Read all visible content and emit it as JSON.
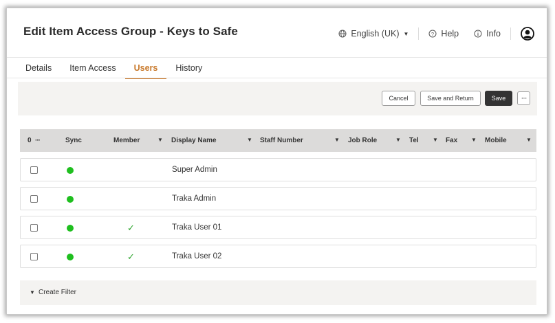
{
  "header": {
    "title": "Edit Item Access Group - Keys to Safe",
    "language": "English (UK)",
    "help": "Help",
    "info": "Info"
  },
  "tabs": [
    {
      "label": "Details",
      "active": false
    },
    {
      "label": "Item Access",
      "active": false
    },
    {
      "label": "Users",
      "active": true
    },
    {
      "label": "History",
      "active": false
    }
  ],
  "toolbar": {
    "cancel": "Cancel",
    "save_and_return": "Save and Return",
    "save": "Save",
    "more": "···"
  },
  "grid": {
    "selected_count": "0",
    "more": "···",
    "columns": [
      "Sync",
      "Member",
      "Display Name",
      "Staff Number",
      "Job Role",
      "Tel",
      "Fax",
      "Mobile"
    ],
    "rows": [
      {
        "display_name": "Super Admin",
        "member": false,
        "synced": true
      },
      {
        "display_name": "Traka Admin",
        "member": false,
        "synced": true
      },
      {
        "display_name": "Traka User 01",
        "member": true,
        "synced": true
      },
      {
        "display_name": "Traka User 02",
        "member": true,
        "synced": true
      }
    ],
    "member_mark": "✓"
  },
  "filter_bar": {
    "label": "Create Filter"
  },
  "colors": {
    "accent": "#c8782a",
    "sync_green": "#1fbf1f",
    "save_button": "#333333"
  }
}
